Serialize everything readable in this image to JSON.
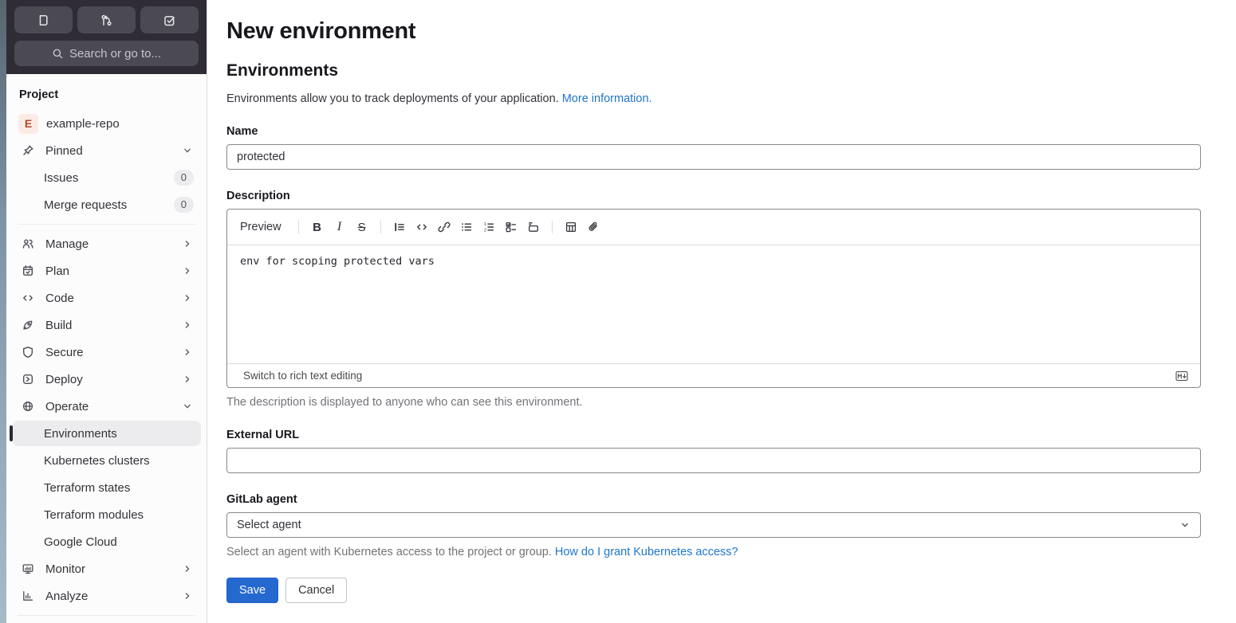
{
  "colors": {
    "sidebar_header_bg": "#2f2c36",
    "sidebar_button_bg": "#4b4952",
    "active_item_bg": "#ececef",
    "link_blue": "#1f75cb",
    "save_button_blue": "#2568cf",
    "avatar_bg": "#fcebe5",
    "avatar_text": "#b04a2b"
  },
  "sidebar": {
    "shortcuts": [
      {
        "icon": "issues-shortcut-icon"
      },
      {
        "icon": "merge-request-shortcut-icon"
      },
      {
        "icon": "todo-shortcut-icon"
      }
    ],
    "search_label": "Search or go to...",
    "section_label": "Project",
    "project": {
      "initial": "E",
      "name": "example-repo"
    },
    "items": [
      {
        "label": "Pinned",
        "icon": "pin-icon",
        "chevron": "down"
      },
      {
        "label": "Issues",
        "badge": "0",
        "sub": true
      },
      {
        "label": "Merge requests",
        "badge": "0",
        "sub": true
      },
      {
        "label": "Manage",
        "icon": "users-icon",
        "chevron": "right"
      },
      {
        "label": "Plan",
        "icon": "calendar-icon",
        "chevron": "right"
      },
      {
        "label": "Code",
        "icon": "code-icon",
        "chevron": "right"
      },
      {
        "label": "Build",
        "icon": "rocket-icon",
        "chevron": "right"
      },
      {
        "label": "Secure",
        "icon": "shield-icon",
        "chevron": "right"
      },
      {
        "label": "Deploy",
        "icon": "deploy-icon",
        "chevron": "right"
      },
      {
        "label": "Operate",
        "icon": "globe-icon",
        "chevron": "down"
      },
      {
        "label": "Environments",
        "sub": true,
        "active": true
      },
      {
        "label": "Kubernetes clusters",
        "sub": true
      },
      {
        "label": "Terraform states",
        "sub": true
      },
      {
        "label": "Terraform modules",
        "sub": true
      },
      {
        "label": "Google Cloud",
        "sub": true
      },
      {
        "label": "Monitor",
        "icon": "monitor-icon",
        "chevron": "right"
      },
      {
        "label": "Analyze",
        "icon": "chart-icon",
        "chevron": "right"
      }
    ]
  },
  "main": {
    "page_title": "New environment",
    "section_title": "Environments",
    "intro_text": "Environments allow you to track deployments of your application.",
    "intro_link": "More information.",
    "name_field": {
      "label": "Name",
      "value": "protected"
    },
    "description_field": {
      "label": "Description",
      "preview_label": "Preview",
      "toolbar_icons": [
        "bold",
        "italic",
        "strikethrough",
        "quote",
        "code",
        "link",
        "bullet-list",
        "numbered-list",
        "task-list",
        "collapsible-section",
        "table",
        "attach-file"
      ],
      "content": "env for scoping protected vars",
      "switch_label": "Switch to rich text editing",
      "markdown_icon": "markdown-icon",
      "help_text": "The description is displayed to anyone who can see this environment."
    },
    "external_url_field": {
      "label": "External URL",
      "value": ""
    },
    "agent_field": {
      "label": "GitLab agent",
      "value": "Select agent",
      "help_text": "Select an agent with Kubernetes access to the project or group.",
      "help_link": "How do I grant Kubernetes access?"
    },
    "save_label": "Save",
    "cancel_label": "Cancel"
  }
}
